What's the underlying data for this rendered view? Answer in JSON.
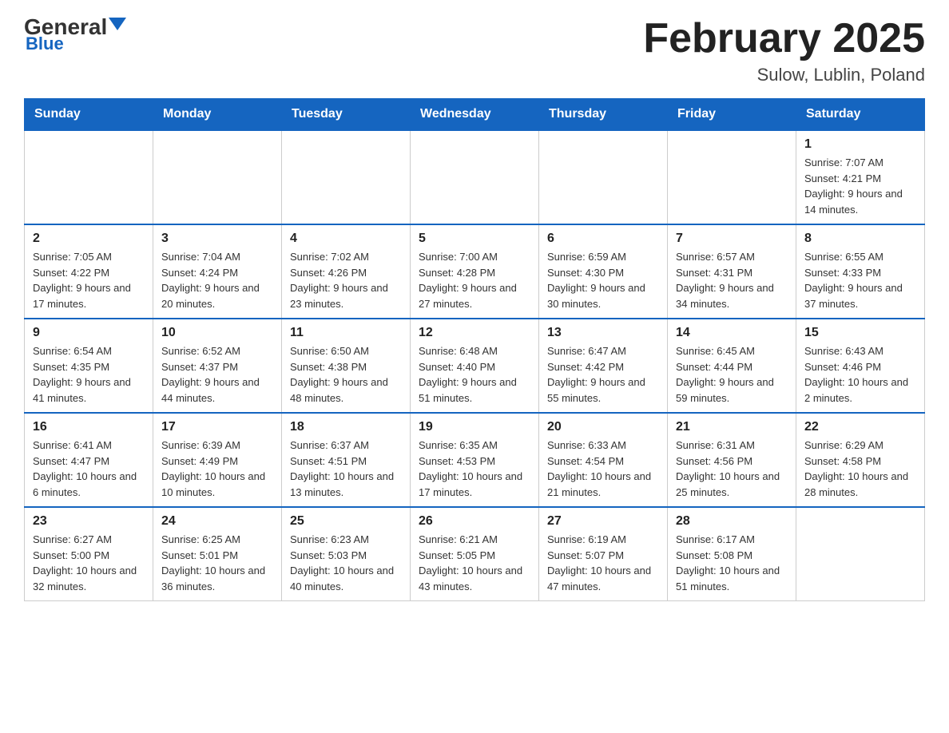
{
  "header": {
    "logo_general": "General",
    "logo_blue": "Blue",
    "month_title": "February 2025",
    "location": "Sulow, Lublin, Poland"
  },
  "days_of_week": [
    "Sunday",
    "Monday",
    "Tuesday",
    "Wednesday",
    "Thursday",
    "Friday",
    "Saturday"
  ],
  "weeks": [
    {
      "days": [
        {
          "num": "",
          "info": ""
        },
        {
          "num": "",
          "info": ""
        },
        {
          "num": "",
          "info": ""
        },
        {
          "num": "",
          "info": ""
        },
        {
          "num": "",
          "info": ""
        },
        {
          "num": "",
          "info": ""
        },
        {
          "num": "1",
          "info": "Sunrise: 7:07 AM\nSunset: 4:21 PM\nDaylight: 9 hours and 14 minutes."
        }
      ]
    },
    {
      "days": [
        {
          "num": "2",
          "info": "Sunrise: 7:05 AM\nSunset: 4:22 PM\nDaylight: 9 hours and 17 minutes."
        },
        {
          "num": "3",
          "info": "Sunrise: 7:04 AM\nSunset: 4:24 PM\nDaylight: 9 hours and 20 minutes."
        },
        {
          "num": "4",
          "info": "Sunrise: 7:02 AM\nSunset: 4:26 PM\nDaylight: 9 hours and 23 minutes."
        },
        {
          "num": "5",
          "info": "Sunrise: 7:00 AM\nSunset: 4:28 PM\nDaylight: 9 hours and 27 minutes."
        },
        {
          "num": "6",
          "info": "Sunrise: 6:59 AM\nSunset: 4:30 PM\nDaylight: 9 hours and 30 minutes."
        },
        {
          "num": "7",
          "info": "Sunrise: 6:57 AM\nSunset: 4:31 PM\nDaylight: 9 hours and 34 minutes."
        },
        {
          "num": "8",
          "info": "Sunrise: 6:55 AM\nSunset: 4:33 PM\nDaylight: 9 hours and 37 minutes."
        }
      ]
    },
    {
      "days": [
        {
          "num": "9",
          "info": "Sunrise: 6:54 AM\nSunset: 4:35 PM\nDaylight: 9 hours and 41 minutes."
        },
        {
          "num": "10",
          "info": "Sunrise: 6:52 AM\nSunset: 4:37 PM\nDaylight: 9 hours and 44 minutes."
        },
        {
          "num": "11",
          "info": "Sunrise: 6:50 AM\nSunset: 4:38 PM\nDaylight: 9 hours and 48 minutes."
        },
        {
          "num": "12",
          "info": "Sunrise: 6:48 AM\nSunset: 4:40 PM\nDaylight: 9 hours and 51 minutes."
        },
        {
          "num": "13",
          "info": "Sunrise: 6:47 AM\nSunset: 4:42 PM\nDaylight: 9 hours and 55 minutes."
        },
        {
          "num": "14",
          "info": "Sunrise: 6:45 AM\nSunset: 4:44 PM\nDaylight: 9 hours and 59 minutes."
        },
        {
          "num": "15",
          "info": "Sunrise: 6:43 AM\nSunset: 4:46 PM\nDaylight: 10 hours and 2 minutes."
        }
      ]
    },
    {
      "days": [
        {
          "num": "16",
          "info": "Sunrise: 6:41 AM\nSunset: 4:47 PM\nDaylight: 10 hours and 6 minutes."
        },
        {
          "num": "17",
          "info": "Sunrise: 6:39 AM\nSunset: 4:49 PM\nDaylight: 10 hours and 10 minutes."
        },
        {
          "num": "18",
          "info": "Sunrise: 6:37 AM\nSunset: 4:51 PM\nDaylight: 10 hours and 13 minutes."
        },
        {
          "num": "19",
          "info": "Sunrise: 6:35 AM\nSunset: 4:53 PM\nDaylight: 10 hours and 17 minutes."
        },
        {
          "num": "20",
          "info": "Sunrise: 6:33 AM\nSunset: 4:54 PM\nDaylight: 10 hours and 21 minutes."
        },
        {
          "num": "21",
          "info": "Sunrise: 6:31 AM\nSunset: 4:56 PM\nDaylight: 10 hours and 25 minutes."
        },
        {
          "num": "22",
          "info": "Sunrise: 6:29 AM\nSunset: 4:58 PM\nDaylight: 10 hours and 28 minutes."
        }
      ]
    },
    {
      "days": [
        {
          "num": "23",
          "info": "Sunrise: 6:27 AM\nSunset: 5:00 PM\nDaylight: 10 hours and 32 minutes."
        },
        {
          "num": "24",
          "info": "Sunrise: 6:25 AM\nSunset: 5:01 PM\nDaylight: 10 hours and 36 minutes."
        },
        {
          "num": "25",
          "info": "Sunrise: 6:23 AM\nSunset: 5:03 PM\nDaylight: 10 hours and 40 minutes."
        },
        {
          "num": "26",
          "info": "Sunrise: 6:21 AM\nSunset: 5:05 PM\nDaylight: 10 hours and 43 minutes."
        },
        {
          "num": "27",
          "info": "Sunrise: 6:19 AM\nSunset: 5:07 PM\nDaylight: 10 hours and 47 minutes."
        },
        {
          "num": "28",
          "info": "Sunrise: 6:17 AM\nSunset: 5:08 PM\nDaylight: 10 hours and 51 minutes."
        },
        {
          "num": "",
          "info": ""
        }
      ]
    }
  ]
}
